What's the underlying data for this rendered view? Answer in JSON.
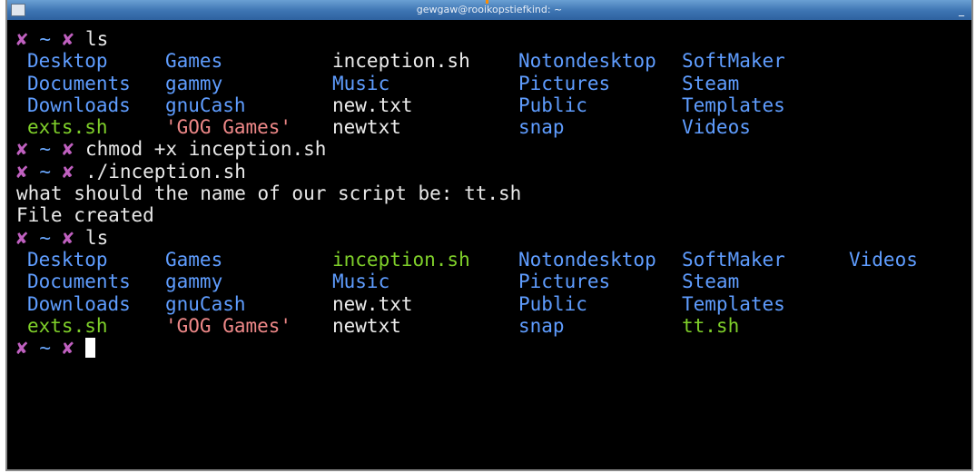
{
  "window": {
    "title": "gewgaw@rooikopstiefkind: ~",
    "minimize_label": "_"
  },
  "prompt": {
    "x1": "✘",
    "tilde": "~",
    "x2": "✘"
  },
  "terminal": {
    "cmd1": "ls",
    "ls1": [
      [
        "Desktop",
        "Games",
        "inception.sh",
        "Notondesktop",
        "SoftMaker",
        ""
      ],
      [
        "Documents",
        "gammy",
        "Music",
        "Pictures",
        "Steam",
        ""
      ],
      [
        "Downloads",
        "gnuCash",
        "new.txt",
        "Public",
        "Templates",
        ""
      ],
      [
        "exts.sh",
        "'GOG Games'",
        "newtxt",
        "snap",
        "Videos",
        ""
      ]
    ],
    "cmd2": "chmod +x inception.sh",
    "cmd3": "./inception.sh",
    "out1": "what should the name of our script be: tt.sh",
    "out2": "File created",
    "cmd4": "ls",
    "ls2": [
      [
        "Desktop",
        "Games",
        "inception.sh",
        "Notondesktop",
        "SoftMaker",
        "Videos"
      ],
      [
        "Documents",
        "gammy",
        "Music",
        "Pictures",
        "Steam",
        ""
      ],
      [
        "Downloads",
        "gnuCash",
        "new.txt",
        "Public",
        "Templates",
        ""
      ],
      [
        "exts.sh",
        "'GOG Games'",
        "newtxt",
        "snap",
        "tt.sh",
        ""
      ]
    ]
  },
  "colors": {
    "directory": "#5f9dff",
    "executable": "#7fd02a",
    "plain": "#ececec",
    "quoted": "#ee8888",
    "prompt_x": "#c060c0"
  }
}
